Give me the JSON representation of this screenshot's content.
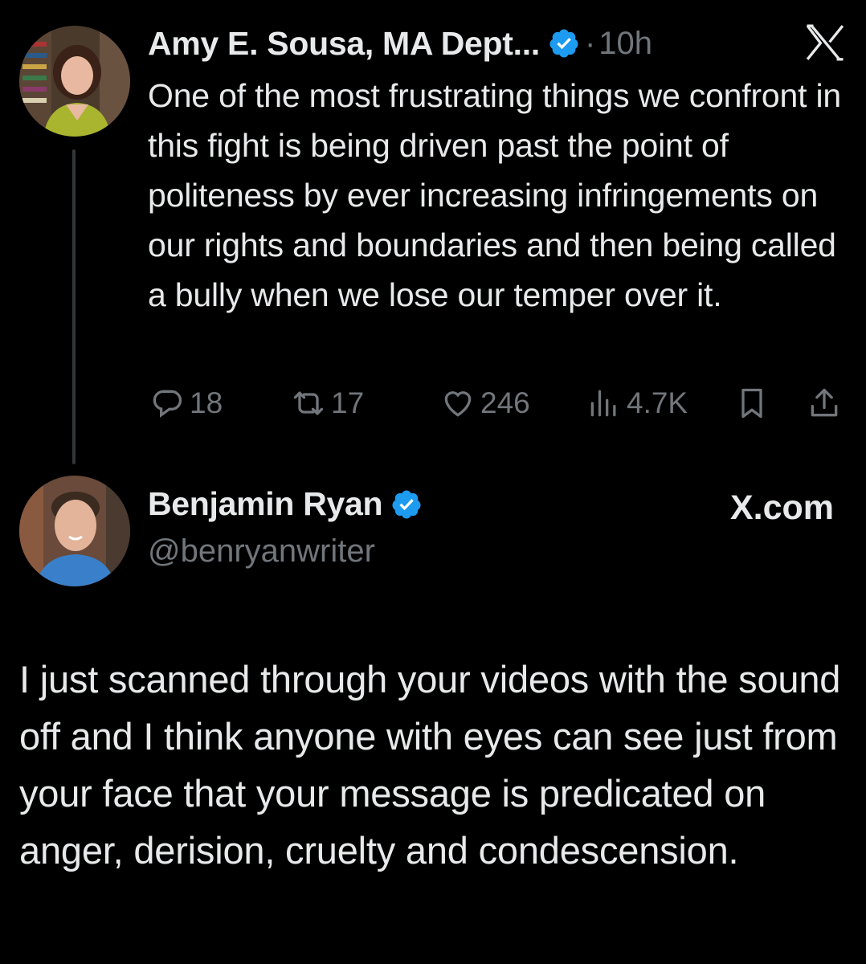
{
  "tweet": {
    "author_name": "Amy E. Sousa, MA Dept...",
    "separator": "·",
    "time": "10h",
    "text": "One of the most frustrating things we confront in this fight is being driven past the point of politeness by ever increasing infringements on our rights and boundaries and then being called a bully when we lose our temper over it.",
    "stats": {
      "replies": "18",
      "retweets": "17",
      "likes": "246",
      "views": "4.7K"
    }
  },
  "quoted": {
    "author_name": "Benjamin Ryan",
    "handle": "@benryanwriter",
    "brand": "X.com",
    "text": "I just scanned through your videos with the sound off and I think anyone with eyes can see just from your face that your message is predicated on anger, derision, cruelty and condescension."
  },
  "colors": {
    "background": "#000000",
    "primary_text": "#e7e9ea",
    "secondary_text": "#71767b",
    "verified_blue": "#1d9bf0"
  },
  "icons": [
    "verified-badge-icon",
    "x-logo-icon",
    "reply-icon",
    "retweet-icon",
    "like-icon",
    "views-icon",
    "bookmark-icon",
    "share-icon"
  ]
}
